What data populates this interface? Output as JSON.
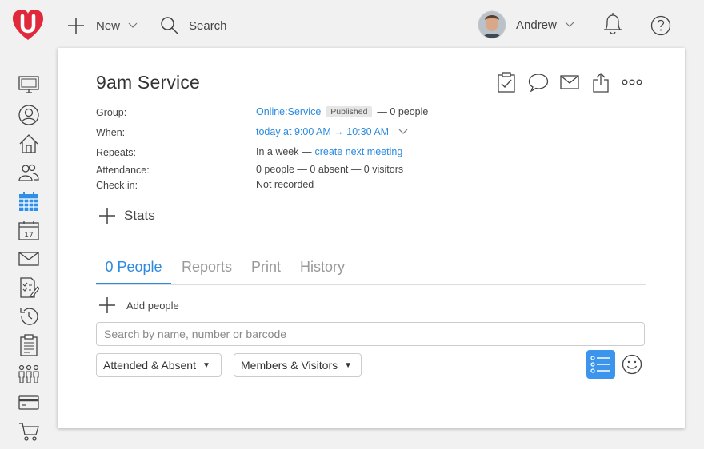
{
  "topbar": {
    "new_label": "New",
    "search_label": "Search",
    "user_name": "Andrew"
  },
  "event": {
    "title": "9am Service",
    "fields": {
      "group_label": "Group:",
      "group_link": "Online:Service",
      "group_badge": "Published",
      "group_suffix": "— 0 people",
      "when_label": "When:",
      "when_value": "today at 9:00 AM → 10:30 AM",
      "repeats_label": "Repeats:",
      "repeats_text": "In a week —",
      "repeats_link": "create next meeting",
      "attendance_label": "Attendance:",
      "attendance_value": "0 people — 0 absent — 0 visitors",
      "checkin_label": "Check in:",
      "checkin_value": "Not recorded"
    }
  },
  "stats_label": "Stats",
  "tabs": [
    {
      "label": "0 People",
      "active": true
    },
    {
      "label": "Reports",
      "active": false
    },
    {
      "label": "Print",
      "active": false
    },
    {
      "label": "History",
      "active": false
    }
  ],
  "add_people_label": "Add people",
  "search": {
    "placeholder": "Search by name, number or barcode",
    "value": ""
  },
  "filters": {
    "attendance": "Attended & Absent",
    "membership": "Members & Visitors"
  },
  "colors": {
    "accent": "#2b8be0",
    "brand_red": "#e0293a",
    "calendar_active": "#2f8fe6"
  }
}
